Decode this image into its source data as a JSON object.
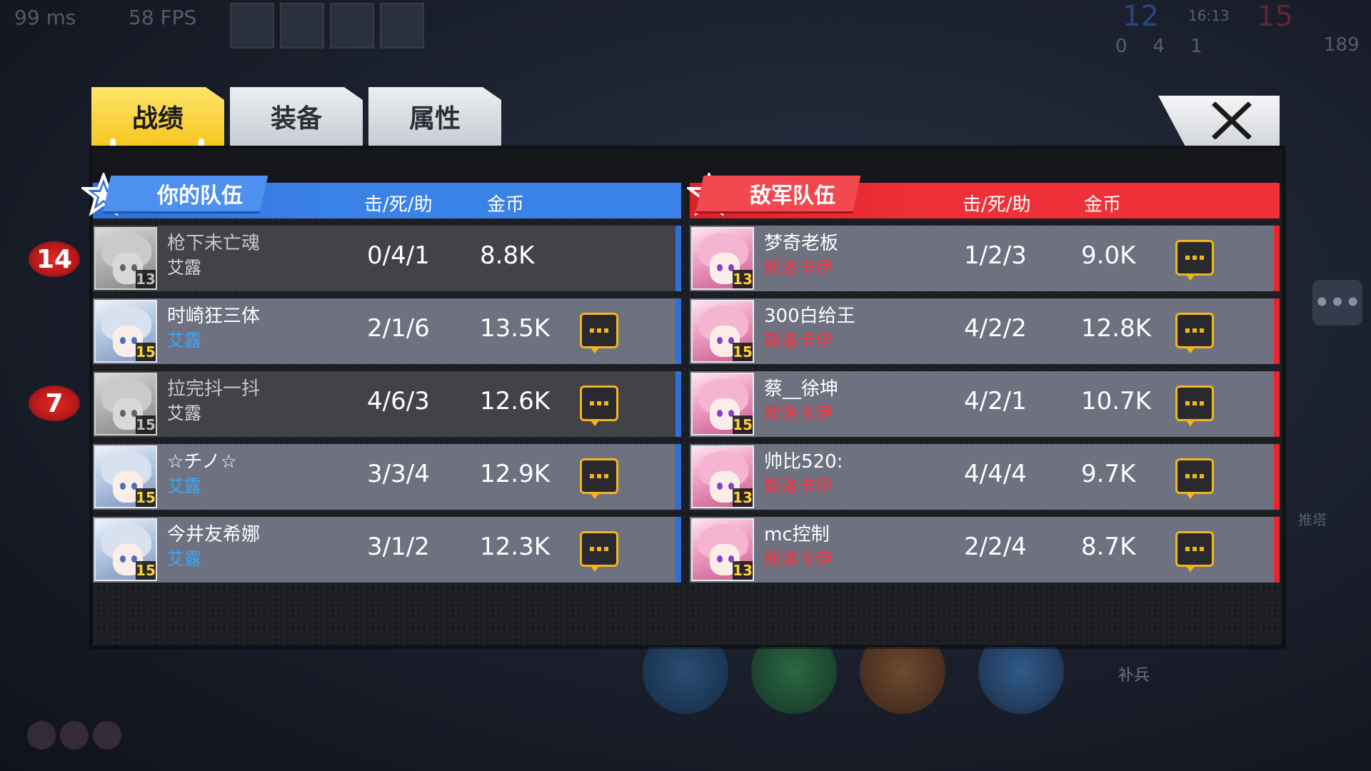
{
  "hud": {
    "ping": "99 ms",
    "fps": "58 FPS",
    "score_blue": "12",
    "time": "16:13",
    "score_red": "15",
    "stat_a": "0",
    "stat_b": "4",
    "stat_c": "1",
    "gold_total": "189",
    "side_badge_1": "14",
    "side_badge_2": "7",
    "tower_label": "推塔",
    "minion_label": "补兵"
  },
  "tabs": [
    {
      "label": "战绩",
      "active": true
    },
    {
      "label": "装备",
      "active": false
    },
    {
      "label": "属性",
      "active": false
    }
  ],
  "close_icon": "close-x-icon",
  "colors": {
    "ally": "#2f6fd6",
    "enemy": "#e8262e",
    "tab_active": "#f6c720",
    "chat_border": "#f3b61a"
  },
  "ally_team": {
    "title": "你的队伍",
    "kda_header": "击/死/助",
    "gold_header": "金币",
    "players": [
      {
        "name": "枪下未亡魂",
        "hero": "艾露",
        "level": "13",
        "kda": "0/4/1",
        "gold": "8.8K",
        "dead": true,
        "chat": false
      },
      {
        "name": "时崎狂三体",
        "hero": "艾露",
        "level": "15",
        "kda": "2/1/6",
        "gold": "13.5K",
        "dead": false,
        "chat": true
      },
      {
        "name": "拉完抖一抖",
        "hero": "艾露",
        "level": "15",
        "kda": "4/6/3",
        "gold": "12.6K",
        "dead": true,
        "chat": true
      },
      {
        "name": "☆チノ☆",
        "hero": "艾露",
        "level": "15",
        "kda": "3/3/4",
        "gold": "12.9K",
        "dead": false,
        "chat": true
      },
      {
        "name": "今井友希娜",
        "hero": "艾露",
        "level": "15",
        "kda": "3/1/2",
        "gold": "12.3K",
        "dead": false,
        "chat": true
      }
    ]
  },
  "enemy_team": {
    "title": "敌军队伍",
    "kda_header": "击/死/助",
    "gold_header": "金币",
    "players": [
      {
        "name": "梦奇老板",
        "hero": "斯洛卡伊",
        "level": "13",
        "kda": "1/2/3",
        "gold": "9.0K",
        "chat": true
      },
      {
        "name": "300白给王",
        "hero": "斯洛卡伊",
        "level": "15",
        "kda": "4/2/2",
        "gold": "12.8K",
        "chat": true
      },
      {
        "name": "蔡__徐坤",
        "hero": "斯洛卡伊",
        "level": "15",
        "kda": "4/2/1",
        "gold": "10.7K",
        "chat": true
      },
      {
        "name": "帅比520:",
        "hero": "斯洛卡伊",
        "level": "13",
        "kda": "4/4/4",
        "gold": "9.7K",
        "chat": true
      },
      {
        "name": "mc控制",
        "hero": "斯洛卡伊",
        "level": "13",
        "kda": "2/2/4",
        "gold": "8.7K",
        "chat": true
      }
    ]
  }
}
